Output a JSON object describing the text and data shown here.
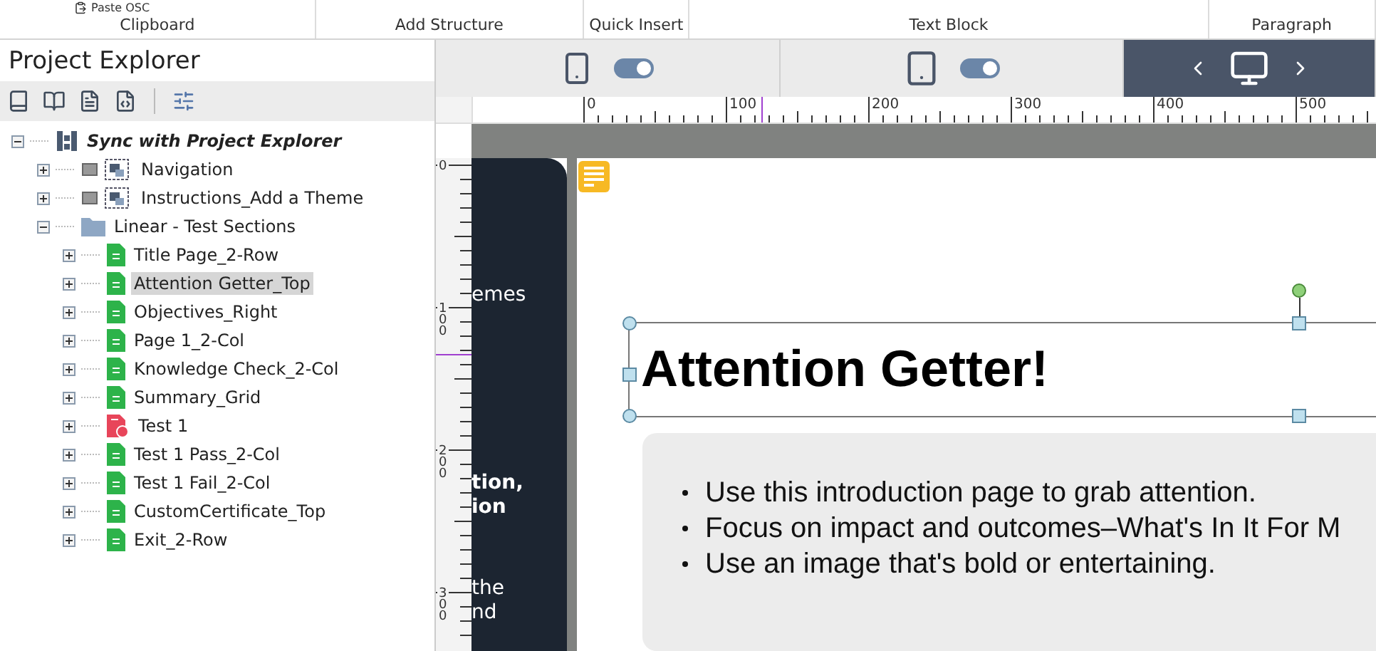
{
  "ribbon": {
    "top_item": "Paste OSC",
    "groups": [
      "Clipboard",
      "Add Structure",
      "Quick Insert",
      "Text Block",
      "Paragraph"
    ]
  },
  "project_explorer": {
    "title": "Project Explorer",
    "tree": [
      {
        "label": "Sync with Project Explorer",
        "kind": "sync",
        "expanded": true,
        "selected": false,
        "children": [
          {
            "label": "Navigation",
            "kind": "group",
            "expanded": false,
            "selected": false
          },
          {
            "label": "Instructions_Add a Theme",
            "kind": "group",
            "expanded": false,
            "selected": false
          },
          {
            "label": "Linear - Test Sections",
            "kind": "folder",
            "expanded": true,
            "selected": false,
            "children": [
              {
                "label": "Title Page_2-Row",
                "kind": "page",
                "expanded": false,
                "selected": false
              },
              {
                "label": "Attention Getter_Top",
                "kind": "page",
                "expanded": false,
                "selected": true
              },
              {
                "label": "Objectives_Right",
                "kind": "page",
                "expanded": false,
                "selected": false
              },
              {
                "label": "Page 1_2-Col",
                "kind": "page",
                "expanded": false,
                "selected": false
              },
              {
                "label": "Knowledge Check_2-Col",
                "kind": "page",
                "expanded": false,
                "selected": false
              },
              {
                "label": "Summary_Grid",
                "kind": "page",
                "expanded": false,
                "selected": false
              },
              {
                "label": "Test 1",
                "kind": "test",
                "expanded": false,
                "selected": false
              },
              {
                "label": "Test 1 Pass_2-Col",
                "kind": "page",
                "expanded": false,
                "selected": false
              },
              {
                "label": "Test 1 Fail_2-Col",
                "kind": "page",
                "expanded": false,
                "selected": false
              },
              {
                "label": "CustomCertificate_Top",
                "kind": "page",
                "expanded": false,
                "selected": false
              },
              {
                "label": "Exit_2-Row",
                "kind": "page",
                "expanded": false,
                "selected": false
              }
            ]
          }
        ]
      }
    ]
  },
  "devices": [
    {
      "kind": "phone",
      "selected": false,
      "on": true
    },
    {
      "kind": "tablet",
      "selected": false,
      "on": true
    },
    {
      "kind": "desktop",
      "selected": true
    }
  ],
  "ruler": {
    "horizontal": [
      "0",
      "100",
      "200",
      "300",
      "400",
      "500"
    ],
    "vertical": [
      "0",
      "100",
      "200",
      "300"
    ]
  },
  "side_panel": [
    {
      "lines": [
        "emes"
      ],
      "bold": false
    },
    {
      "lines": [
        "tion,",
        "ion"
      ],
      "bold": true
    },
    {
      "lines": [
        "the",
        "nd"
      ],
      "bold": false
    }
  ],
  "page": {
    "title": "Attention Getter!",
    "bullets": [
      "Use this introduction page to grab attention.",
      "Focus on impact and outcomes–What's In It For M",
      "Use an image that's bold or entertaining."
    ]
  }
}
